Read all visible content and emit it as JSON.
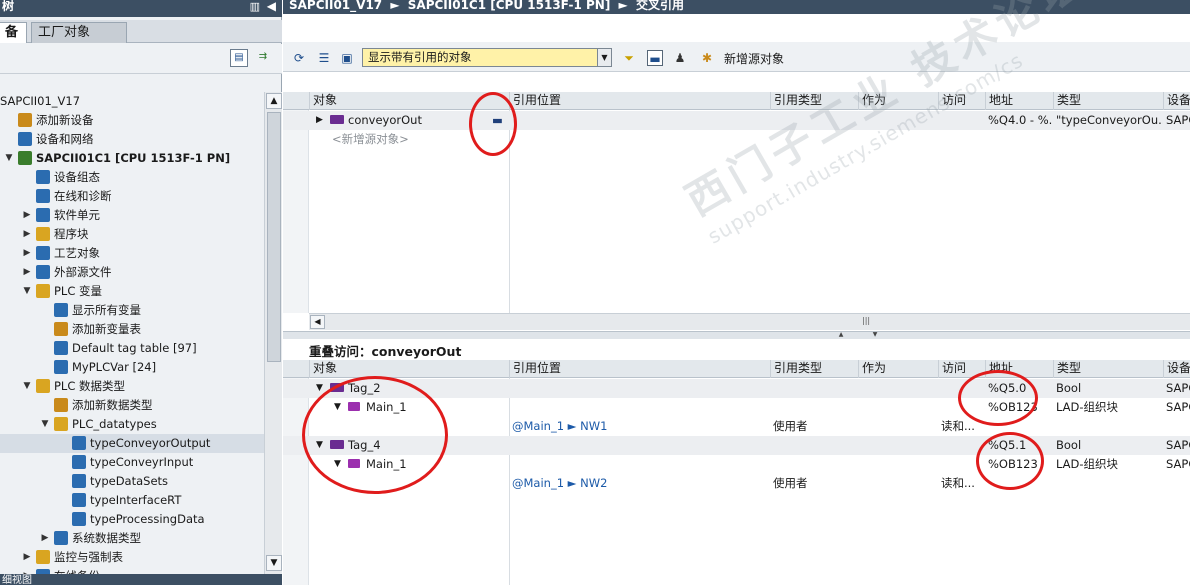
{
  "left_panel": {
    "title": "树",
    "tabs": [
      "备",
      "工厂对象"
    ],
    "tree": [
      {
        "label": "SAPCII01_V17",
        "indent": 0,
        "arrow": "",
        "icon": "",
        "color": "#333"
      },
      {
        "label": "添加新设备",
        "indent": 1,
        "arrow": "",
        "icon": "add-device-icon",
        "color": "#c98a1b"
      },
      {
        "label": "设备和网络",
        "indent": 1,
        "arrow": "",
        "icon": "network-icon",
        "color": "#2b6cb0"
      },
      {
        "label": "SAPCII01C1 [CPU 1513F-1 PN]",
        "indent": 1,
        "arrow": "▼",
        "icon": "cpu-icon",
        "color": "#3a7d2c",
        "bold": true
      },
      {
        "label": "设备组态",
        "indent": 2,
        "arrow": "",
        "icon": "device-config-icon",
        "color": "#2b6cb0"
      },
      {
        "label": "在线和诊断",
        "indent": 2,
        "arrow": "",
        "icon": "diagnostics-icon",
        "color": "#2b6cb0"
      },
      {
        "label": "软件单元",
        "indent": 2,
        "arrow": "▶",
        "icon": "software-unit-icon",
        "color": "#2b6cb0"
      },
      {
        "label": "程序块",
        "indent": 2,
        "arrow": "▶",
        "icon": "folder-icon",
        "color": "#d9a521"
      },
      {
        "label": "工艺对象",
        "indent": 2,
        "arrow": "▶",
        "icon": "tech-object-icon",
        "color": "#2b6cb0"
      },
      {
        "label": "外部源文件",
        "indent": 2,
        "arrow": "▶",
        "icon": "external-source-icon",
        "color": "#2b6cb0"
      },
      {
        "label": "PLC 变量",
        "indent": 2,
        "arrow": "▼",
        "icon": "folder-icon",
        "color": "#d9a521"
      },
      {
        "label": "显示所有变量",
        "indent": 3,
        "arrow": "",
        "icon": "show-tags-icon",
        "color": "#2b6cb0"
      },
      {
        "label": "添加新变量表",
        "indent": 3,
        "arrow": "",
        "icon": "add-tag-table-icon",
        "color": "#c98a1b"
      },
      {
        "label": "Default tag table [97]",
        "indent": 3,
        "arrow": "",
        "icon": "tag-table-icon",
        "color": "#2b6cb0"
      },
      {
        "label": "MyPLCVar [24]",
        "indent": 3,
        "arrow": "",
        "icon": "tag-table-icon",
        "color": "#2b6cb0"
      },
      {
        "label": "PLC 数据类型",
        "indent": 2,
        "arrow": "▼",
        "icon": "folder-icon",
        "color": "#d9a521"
      },
      {
        "label": "添加新数据类型",
        "indent": 3,
        "arrow": "",
        "icon": "add-datatype-icon",
        "color": "#c98a1b"
      },
      {
        "label": "PLC_datatypes",
        "indent": 3,
        "arrow": "▼",
        "icon": "folder-icon",
        "color": "#d9a521"
      },
      {
        "label": "typeConveyorOutput",
        "indent": 4,
        "arrow": "",
        "icon": "datatype-icon",
        "color": "#2b6cb0",
        "selected": true
      },
      {
        "label": "typeConveyrInput",
        "indent": 4,
        "arrow": "",
        "icon": "datatype-icon",
        "color": "#2b6cb0"
      },
      {
        "label": "typeDataSets",
        "indent": 4,
        "arrow": "",
        "icon": "datatype-icon",
        "color": "#2b6cb0"
      },
      {
        "label": "typeInterfaceRT",
        "indent": 4,
        "arrow": "",
        "icon": "datatype-icon",
        "color": "#2b6cb0"
      },
      {
        "label": "typeProcessingData",
        "indent": 4,
        "arrow": "",
        "icon": "datatype-icon",
        "color": "#2b6cb0"
      },
      {
        "label": "系统数据类型",
        "indent": 3,
        "arrow": "▶",
        "icon": "system-datatype-icon",
        "color": "#2b6cb0"
      },
      {
        "label": "监控与强制表",
        "indent": 2,
        "arrow": "▶",
        "icon": "watch-table-icon",
        "color": "#d9a521"
      },
      {
        "label": "在线备份",
        "indent": 2,
        "arrow": "▶",
        "icon": "backup-icon",
        "color": "#2b6cb0"
      }
    ],
    "bottom_title": "细视图"
  },
  "breadcrumb": [
    "SAPCII01_V17",
    "SAPCII01C1 [CPU 1513F-1 PN]",
    "交叉引用"
  ],
  "toolbar": {
    "filter_value": "显示带有引用的对象",
    "new_source_label": "新增源对象"
  },
  "upper_grid": {
    "headers": [
      "对象",
      "引用位置",
      "引用类型",
      "作为",
      "访问",
      "地址",
      "类型",
      "设备"
    ],
    "rows": [
      {
        "object": "conveyorOut",
        "address": "%Q4.0 - %...",
        "type": "\"typeConveyorOu...",
        "device": "SAPC..."
      }
    ],
    "placeholder": "<新增源对象>"
  },
  "lower_grid": {
    "title": "重叠访问：conveyorOut",
    "headers": [
      "对象",
      "引用位置",
      "引用类型",
      "作为",
      "访问",
      "地址",
      "类型",
      "设备"
    ],
    "rows": [
      {
        "object": "Tag_2",
        "level": 0,
        "address": "%Q5.0",
        "type": "Bool",
        "device": "SAPC",
        "shade": true
      },
      {
        "object": "Main_1",
        "level": 1,
        "address": "%OB123",
        "type": "LAD-组织块",
        "device": "SAPC"
      },
      {
        "location": "@Main_1 ► NW1",
        "ref_type": "使用者",
        "access": "读和...",
        "level": 2
      },
      {
        "object": "Tag_4",
        "level": 0,
        "address": "%Q5.1",
        "type": "Bool",
        "device": "SAPC",
        "shade": true
      },
      {
        "object": "Main_1",
        "level": 1,
        "address": "%OB123",
        "type": "LAD-组织块",
        "device": "SAPC"
      },
      {
        "location": "@Main_1 ► NW2",
        "ref_type": "使用者",
        "access": "读和...",
        "level": 2
      }
    ]
  },
  "watermark": {
    "line1": "西门子工业 技术论坛",
    "line2": "support.industry.siemens.com/cs"
  },
  "colors": {
    "title_bar": "#3c4f63",
    "filter_bg": "#fff2a8",
    "annotation_red": "#e01c1c",
    "link": "#1c5aa8"
  }
}
